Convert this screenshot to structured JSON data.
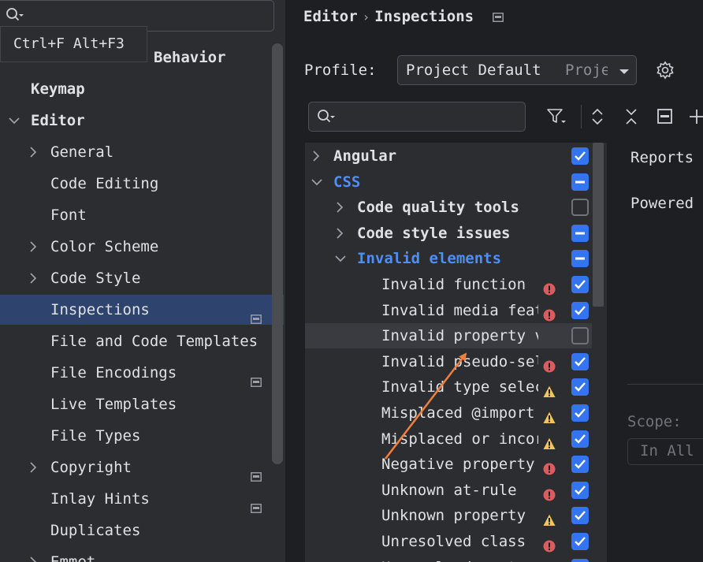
{
  "left_panel": {
    "search_placeholder": "",
    "tooltip": "Ctrl+F Alt+F3",
    "tree": [
      {
        "label": "Appearance & Behavior",
        "visible_label": "Behavior",
        "level": 0,
        "expand": "none",
        "bold": true
      },
      {
        "label": "Keymap",
        "level": 0,
        "expand": "none",
        "bold": true
      },
      {
        "label": "Editor",
        "level": 0,
        "expand": "expanded",
        "bold": true
      },
      {
        "label": "General",
        "level": 1,
        "expand": "collapsed"
      },
      {
        "label": "Code Editing",
        "level": 1,
        "expand": "none"
      },
      {
        "label": "Font",
        "level": 1,
        "expand": "none"
      },
      {
        "label": "Color Scheme",
        "level": 1,
        "expand": "collapsed"
      },
      {
        "label": "Code Style",
        "level": 1,
        "expand": "collapsed"
      },
      {
        "label": "Inspections",
        "level": 1,
        "expand": "none",
        "selected": true,
        "project_icon": true
      },
      {
        "label": "File and Code Templates",
        "level": 1,
        "expand": "none"
      },
      {
        "label": "File Encodings",
        "level": 1,
        "expand": "none",
        "project_icon": true
      },
      {
        "label": "Live Templates",
        "level": 1,
        "expand": "none"
      },
      {
        "label": "File Types",
        "level": 1,
        "expand": "none"
      },
      {
        "label": "Copyright",
        "level": 1,
        "expand": "collapsed",
        "project_icon": true
      },
      {
        "label": "Inlay Hints",
        "level": 1,
        "expand": "none",
        "project_icon": true
      },
      {
        "label": "Duplicates",
        "level": 1,
        "expand": "none"
      },
      {
        "label": "Emmet",
        "level": 1,
        "expand": "collapsed"
      }
    ]
  },
  "header": {
    "breadcrumb": [
      "Editor",
      "Inspections"
    ]
  },
  "profile": {
    "label": "Profile:",
    "value": "Project Default",
    "scope": "Project"
  },
  "inspection_search_placeholder": "",
  "inspections": [
    {
      "label": "Angular",
      "level": 0,
      "expand": "collapsed",
      "bold": true,
      "check": "checked"
    },
    {
      "label": "CSS",
      "level": 0,
      "expand": "expanded",
      "bold": true,
      "blue": true,
      "check": "mixed"
    },
    {
      "label": "Code quality tools",
      "level": 1,
      "expand": "collapsed",
      "bold": true,
      "check": "empty"
    },
    {
      "label": "Code style issues",
      "level": 1,
      "expand": "collapsed",
      "bold": true,
      "check": "mixed"
    },
    {
      "label": "Invalid elements",
      "level": 1,
      "expand": "expanded",
      "bold": true,
      "blue": true,
      "check": "mixed"
    },
    {
      "label": "Invalid function",
      "level": 2,
      "severity": "error",
      "check": "checked"
    },
    {
      "label": "Invalid media feature",
      "level": 2,
      "severity": "error",
      "check": "checked"
    },
    {
      "label": "Invalid property value",
      "level": 2,
      "severity": "none",
      "check": "empty",
      "highlighted": true
    },
    {
      "label": "Invalid pseudo-selector",
      "level": 2,
      "severity": "error",
      "check": "checked"
    },
    {
      "label": "Invalid type selector",
      "level": 2,
      "severity": "warning",
      "check": "checked"
    },
    {
      "label": "Misplaced @import",
      "level": 2,
      "severity": "warning",
      "check": "checked"
    },
    {
      "label": "Misplaced or incorrect @charset",
      "level": 2,
      "severity": "warning",
      "check": "checked"
    },
    {
      "label": "Negative property value",
      "level": 2,
      "severity": "error",
      "check": "checked"
    },
    {
      "label": "Unknown at-rule",
      "level": 2,
      "severity": "error",
      "check": "checked"
    },
    {
      "label": "Unknown property",
      "level": 2,
      "severity": "warning",
      "check": "checked"
    },
    {
      "label": "Unresolved class",
      "level": 2,
      "severity": "error",
      "check": "checked"
    },
    {
      "label": "Unresolved custom property",
      "level": 2,
      "severity": "error",
      "check": "checked"
    }
  ],
  "description": {
    "line1": "Reports",
    "line2": "Powered",
    "scope_label": "Scope:",
    "scope_value": "In All"
  },
  "colors": {
    "accent": "#3574f0",
    "selection": "#2e436e",
    "error": "#db5c5c",
    "warning": "#f2c55c",
    "link_blue": "#4e8ef7",
    "annotation_arrow": "#f07f3c"
  }
}
